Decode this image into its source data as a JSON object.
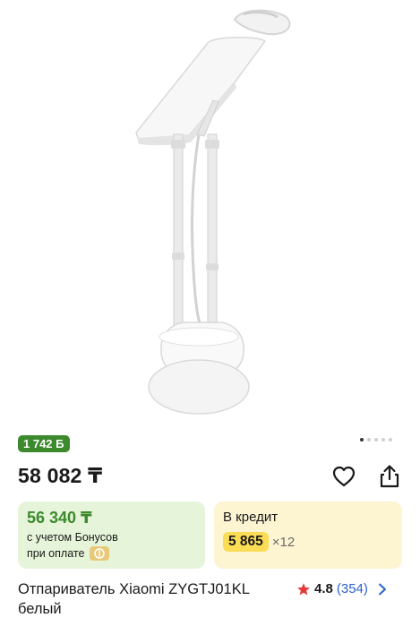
{
  "product": {
    "bonus_badge": "1 742 Б",
    "price": "58 082 ₸",
    "title_line1": "Отпариватель Xiaomi ZYGTJ01KL",
    "title_line2": "белый",
    "rating": "4.8",
    "reviews": "(354)"
  },
  "gallery": {
    "active_index": 0,
    "dot_count": 5,
    "image_subject": "garment steamer"
  },
  "bonus_card": {
    "price": "56 340 ₸",
    "line1": "с учетом Бонусов",
    "line2": "при оплате"
  },
  "credit_card": {
    "title": "В кредит",
    "amount": "5 865",
    "multiplier": "×12"
  },
  "colors": {
    "bonus_green": "#3d8a2e",
    "bonus_bg": "#e6f4d9",
    "credit_bg": "#fdf4d2",
    "credit_highlight": "#fbdc55",
    "star": "#e53935",
    "link_blue": "#2b63c8"
  },
  "icons": [
    "heart-icon",
    "share-icon",
    "star-icon",
    "chevron-right-icon",
    "payment-icon"
  ]
}
